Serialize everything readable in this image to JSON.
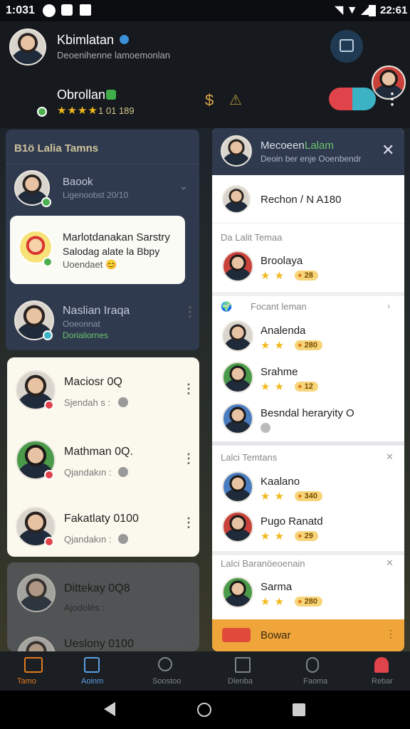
{
  "status_bar": {
    "time_left": "1:031",
    "time_right": "22:61"
  },
  "header": {
    "user1": {
      "name": "Kbimlatan",
      "subtitle": "Deoenihenne lamoemonlan"
    },
    "user2": {
      "name": "Obrollan",
      "rating": "★★★★",
      "rating_text": "1 01 189"
    }
  },
  "left_panel": {
    "title": "B1ö Lalia Tamns",
    "item1": {
      "name": "Baook",
      "sub": "Ligenoobst 20/10"
    },
    "bubble": {
      "line1": "Marlotdanakan Sarstry",
      "line2": "Salodag alate la Bbpy",
      "line3": "Uoendaet 😊"
    },
    "item2": {
      "name": "Naslian Iraqa",
      "sub1": "Ooeonnat",
      "sub2": "Dorialiornes"
    },
    "cards": [
      {
        "name": "Maciosr 0Q",
        "sub": "Sjendah s :"
      },
      {
        "name": "Mathman 0Q.",
        "sub": "Qjandakın :"
      },
      {
        "name": "Fakatlaty 0100",
        "sub": "Qjandakın :"
      },
      {
        "name": "Dittekay 0Q8",
        "sub": "Ajodolés :"
      },
      {
        "name": "Ueslony 0100",
        "sub": ""
      }
    ]
  },
  "right_panel": {
    "header": {
      "title_a": "Mecoeen",
      "title_b": "Lalam",
      "subtitle": "Deoin ber enje Ooenbendr"
    },
    "top_item": "Rechon / N A180",
    "section1": "Da Lalit Temaa",
    "item_a": {
      "name": "Broolaya",
      "coin": "28"
    },
    "section2": "Focant leman",
    "items_b": [
      {
        "name": "Analenda",
        "coin": "280"
      },
      {
        "name": "Srahme",
        "coin": "12"
      },
      {
        "name": "Besndal heraryity O",
        "coin": ""
      }
    ],
    "section3": "Lalci Temtans",
    "items_c": [
      {
        "name": "Kaalano",
        "coin": "340"
      },
      {
        "name": "Pugo Ranatd",
        "coin": "29"
      }
    ],
    "section4": "Lalci Baranöeoenain",
    "items_d": [
      {
        "name": "Sarma",
        "coin": "280"
      }
    ],
    "footer": "Bowar"
  },
  "bottom_nav": [
    "Tamo",
    "Aoinm",
    "Soostoo",
    "Dlenba",
    "Faoma",
    "Rebar"
  ],
  "colors": {
    "navy": "#2f3a4f",
    "card": "#fbf9ee",
    "accent": "#f0a53a",
    "red": "#e0434a",
    "teal": "#3bb3c4"
  }
}
